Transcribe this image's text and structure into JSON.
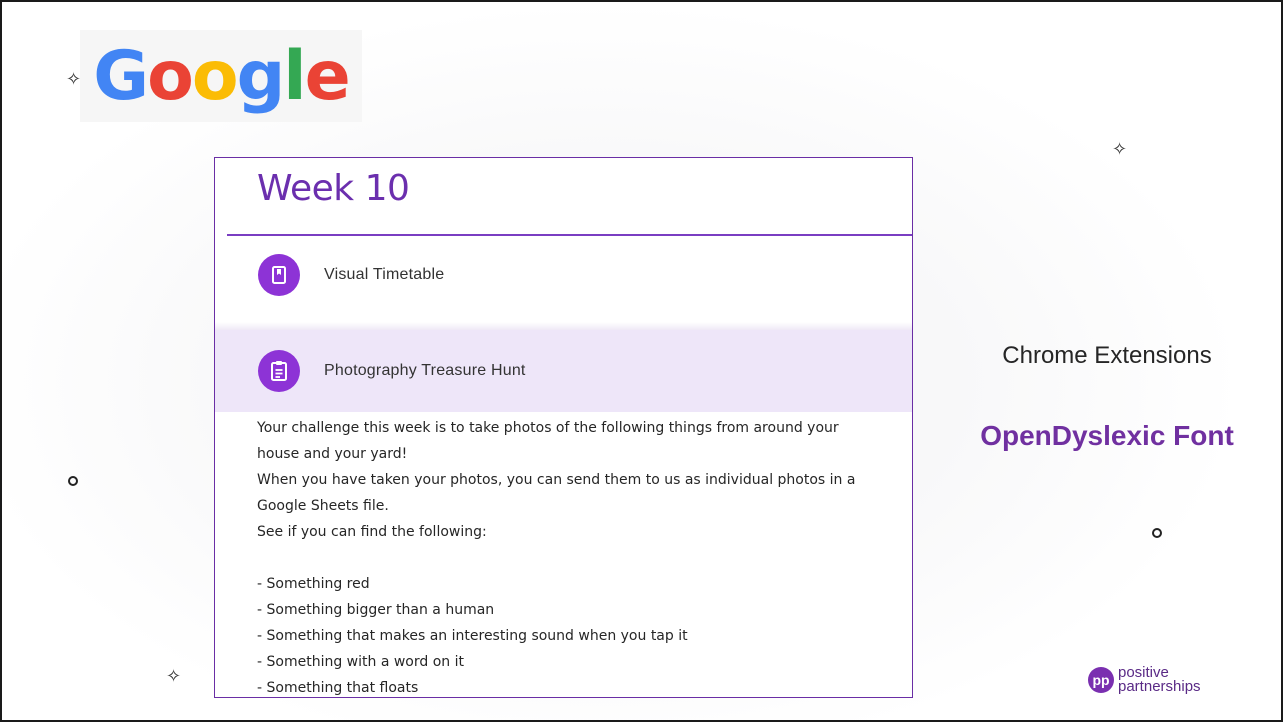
{
  "google_logo": {
    "letters": [
      {
        "char": "G",
        "color": "#4285F4"
      },
      {
        "char": "o",
        "color": "#EA4335"
      },
      {
        "char": "o",
        "color": "#FBBC05"
      },
      {
        "char": "g",
        "color": "#4285F4"
      },
      {
        "char": "l",
        "color": "#34A853"
      },
      {
        "char": "e",
        "color": "#EA4335"
      }
    ]
  },
  "classroom": {
    "week_title": "Week 10",
    "items": [
      {
        "label": "Visual Timetable",
        "icon": "book-icon"
      },
      {
        "label": "Photography Treasure Hunt",
        "icon": "clipboard-icon"
      }
    ],
    "description_lines": [
      "Your challenge this week is to take photos of the following things from around your",
      "house and your yard!",
      "When you have taken your photos, you can send them to us as individual photos in a",
      "Google Sheets file.",
      "See if you can find the following:",
      "",
      "- Something red",
      "- Something bigger than a human",
      "- Something that makes an interesting sound when you tap it",
      "- Something with a word on it",
      "- Something that floats"
    ]
  },
  "side": {
    "heading": "Chrome Extensions",
    "highlight": "OpenDyslexic Font"
  },
  "brand": {
    "mark": "pp",
    "line1": "positive",
    "line2": "partnerships"
  },
  "colors": {
    "accent_purple": "#7030a0",
    "icon_purple": "#8d33d6",
    "highlight_row": "#eee6f9"
  }
}
